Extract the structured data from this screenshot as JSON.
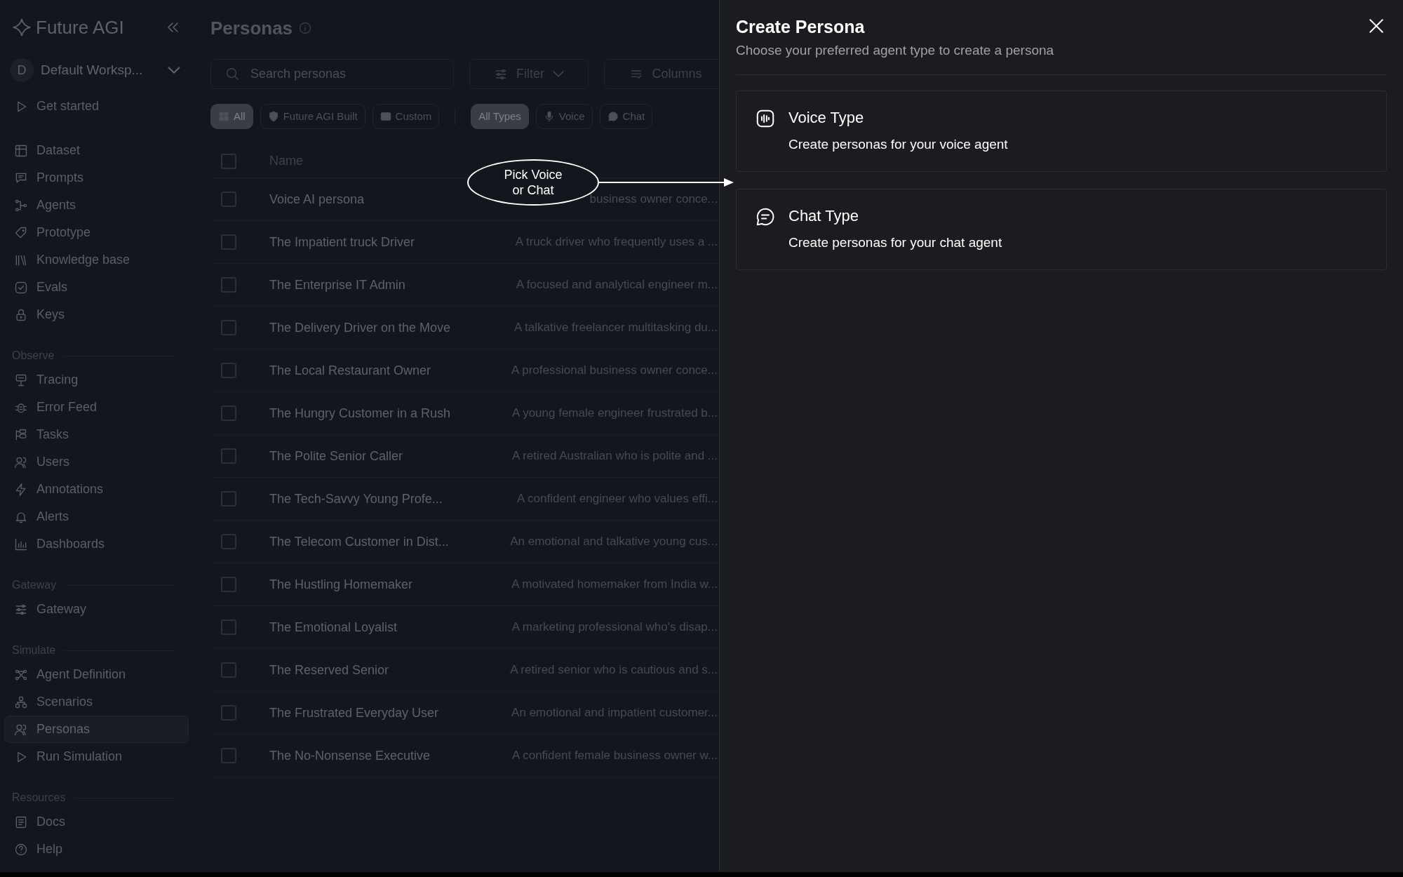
{
  "sidebar": {
    "brand": "Future AGI",
    "workspace": {
      "initial": "D",
      "name": "Default Worksp..."
    },
    "sections": [
      {
        "items": [
          {
            "label": "Get started",
            "selected": false
          }
        ]
      },
      {
        "items": [
          {
            "label": "Dataset",
            "selected": false
          },
          {
            "label": "Prompts",
            "selected": false
          },
          {
            "label": "Agents",
            "selected": false
          },
          {
            "label": "Prototype",
            "selected": false
          },
          {
            "label": "Knowledge base",
            "selected": false
          },
          {
            "label": "Evals",
            "selected": false
          },
          {
            "label": "Keys",
            "selected": false
          }
        ]
      },
      {
        "heading": "Observe",
        "items": [
          {
            "label": "Tracing",
            "selected": false
          },
          {
            "label": "Error Feed",
            "selected": false
          },
          {
            "label": "Tasks",
            "selected": false
          },
          {
            "label": "Users",
            "selected": false
          },
          {
            "label": "Annotations",
            "selected": false
          },
          {
            "label": "Alerts",
            "selected": false
          },
          {
            "label": "Dashboards",
            "selected": false
          }
        ]
      },
      {
        "heading": "Gateway",
        "items": [
          {
            "label": "Gateway",
            "selected": false
          }
        ]
      },
      {
        "heading": "Simulate",
        "items": [
          {
            "label": "Agent Definition",
            "selected": false
          },
          {
            "label": "Scenarios",
            "selected": false
          },
          {
            "label": "Personas",
            "selected": true
          },
          {
            "label": "Run Simulation",
            "selected": false
          }
        ]
      },
      {
        "heading": "Resources",
        "items": [
          {
            "label": "Docs",
            "selected": false
          },
          {
            "label": "Help",
            "selected": false
          }
        ]
      }
    ]
  },
  "page": {
    "title": "Personas",
    "search": {
      "placeholder": "Search personas"
    },
    "buttons": [
      "Filter",
      "Columns"
    ],
    "chip_groups": [
      [
        {
          "label": "All",
          "selected": true
        },
        {
          "label": "Future AGI Built",
          "selected": false
        },
        {
          "label": "Custom",
          "selected": false
        }
      ],
      [
        {
          "label": "All Types",
          "selected": true
        },
        {
          "label": "Voice",
          "selected": false
        },
        {
          "label": "Chat",
          "selected": false
        }
      ]
    ],
    "table": {
      "columns": [
        "Name"
      ],
      "header_checked": false,
      "rows": [
        {
          "name": "Voice AI persona",
          "description": "business owner conce...",
          "checked": false
        },
        {
          "name": "The Impatient truck Driver",
          "description": "A truck driver who frequently uses a ...",
          "checked": false
        },
        {
          "name": "The Enterprise IT Admin",
          "description": "A focused and analytical engineer m...",
          "checked": false
        },
        {
          "name": "The Delivery Driver on the Move",
          "description": "A talkative freelancer multitasking du...",
          "checked": false
        },
        {
          "name": "The Local Restaurant Owner",
          "description": "A professional business owner conce...",
          "checked": false
        },
        {
          "name": "The Hungry Customer in a Rush",
          "description": "A young female engineer frustrated b...",
          "checked": false
        },
        {
          "name": "The Polite Senior Caller",
          "description": "A retired Australian who is polite and ...",
          "checked": false
        },
        {
          "name": "The Tech-Savvy Young Profe...",
          "description": "A confident engineer who values effi...",
          "checked": false
        },
        {
          "name": "The Telecom Customer in Dist...",
          "description": "An emotional and talkative young cus...",
          "checked": false
        },
        {
          "name": "The Hustling Homemaker",
          "description": "A motivated homemaker from India w...",
          "checked": false
        },
        {
          "name": "The Emotional Loyalist",
          "description": "A marketing professional who's disap...",
          "checked": false
        },
        {
          "name": "The Reserved Senior",
          "description": "A retired senior who is cautious and s...",
          "checked": false
        },
        {
          "name": "The Frustrated Everyday User",
          "description": "An emotional and impatient customer...",
          "checked": false
        },
        {
          "name": "The No-Nonsense Executive",
          "description": "A confident female business owner w...",
          "checked": false
        }
      ]
    }
  },
  "callout": {
    "text": "Pick Voice or Chat"
  },
  "drawer": {
    "title": "Create Persona",
    "subtitle": "Choose your preferred agent type to create a persona",
    "options": [
      {
        "kind": "voice",
        "title": "Voice Type",
        "description": "Create personas for your voice agent"
      },
      {
        "kind": "chat",
        "title": "Chat Type",
        "description": "Create personas for your chat agent"
      }
    ]
  }
}
